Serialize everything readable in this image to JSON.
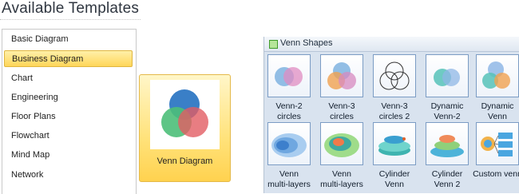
{
  "title": "Available Templates",
  "categories": [
    {
      "label": "Basic Diagram",
      "selected": false
    },
    {
      "label": "Business Diagram",
      "selected": true
    },
    {
      "label": "Chart",
      "selected": false
    },
    {
      "label": "Engineering",
      "selected": false
    },
    {
      "label": "Floor Plans",
      "selected": false
    },
    {
      "label": "Flowchart",
      "selected": false
    },
    {
      "label": "Mind Map",
      "selected": false
    },
    {
      "label": "Network",
      "selected": false
    }
  ],
  "template_tile": {
    "label": "Venn Diagram",
    "icon": "venn-diagram-icon"
  },
  "shapes_panel": {
    "title": "Venn Shapes",
    "shapes": [
      {
        "line1": "Venn-2",
        "line2": "circles",
        "icon": "venn-2-circles-icon"
      },
      {
        "line1": "Venn-3",
        "line2": "circles",
        "icon": "venn-3-circles-icon"
      },
      {
        "line1": "Venn-3",
        "line2": "circles 2",
        "icon": "venn-3-circles-2-icon"
      },
      {
        "line1": "Dynamic",
        "line2": "Venn-2",
        "icon": "dynamic-venn-2-icon"
      },
      {
        "line1": "Dynamic",
        "line2": "Venn",
        "icon": "dynamic-venn-icon"
      },
      {
        "line1": "Venn",
        "line2": "multi-layers",
        "icon": "venn-multi-layers-icon"
      },
      {
        "line1": "Venn",
        "line2": "multi-layers",
        "icon": "venn-multi-layers-2-icon"
      },
      {
        "line1": "Cylinder",
        "line2": "Venn",
        "icon": "cylinder-venn-icon"
      },
      {
        "line1": "Cylinder",
        "line2": "Venn 2",
        "icon": "cylinder-venn-2-icon"
      },
      {
        "line1": "Custom venn",
        "line2": "",
        "icon": "custom-venn-icon"
      }
    ]
  },
  "colors": {
    "selected_bg": "#ffd65a",
    "panel_bg": "#d9e3ef",
    "venn_blue": "#2f78c4",
    "venn_green": "#5cc07a",
    "venn_red": "#e4686a"
  }
}
